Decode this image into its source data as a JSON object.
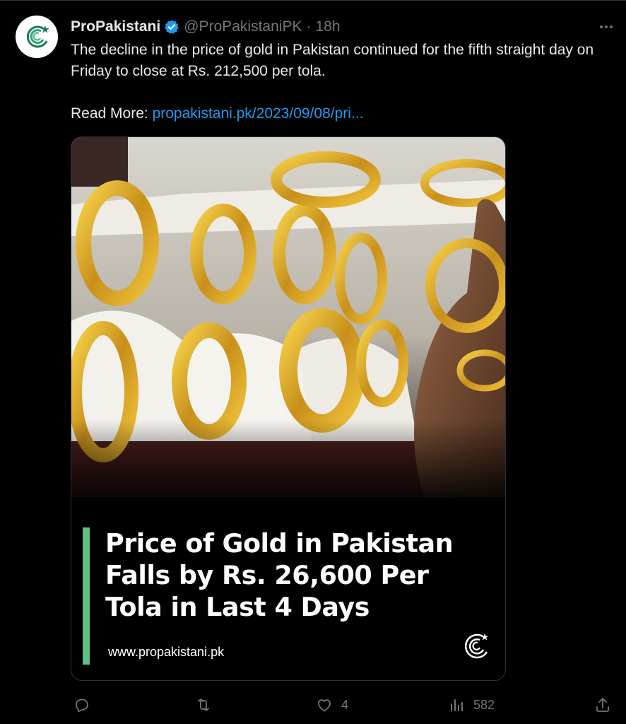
{
  "tweet": {
    "display_name": "ProPakistani",
    "handle": "@ProPakistaniPK",
    "separator": "·",
    "time": "18h",
    "body_line": "The decline in the price of gold in Pakistan continued for the fifth straight day on Friday to close at Rs. 212,500 per tola.",
    "read_more_label": "Read More:",
    "read_more_link": "propakistani.pk/2023/09/08/pri..."
  },
  "media": {
    "headline_lines": [
      "Price of Gold in Pakistan",
      "Falls by Rs. 26,600 Per",
      "Tola in Last 4 Days"
    ],
    "site": "www.propakistani.pk",
    "accent_color": "#5fbf85"
  },
  "actions": {
    "reply_count": "",
    "retweet_count": "",
    "like_count": "4",
    "views_count": "582"
  },
  "icons": {
    "avatar": "propakistani-logo-icon",
    "verified": "verified-badge-icon",
    "more": "more-icon",
    "reply": "reply-icon",
    "retweet": "retweet-icon",
    "like": "heart-icon",
    "views": "views-icon",
    "share": "share-icon"
  },
  "colors": {
    "background": "#000000",
    "text": "#e7e9ea",
    "muted": "#71767b",
    "link": "#1d9bf0",
    "verified": "#1d9bf0"
  }
}
